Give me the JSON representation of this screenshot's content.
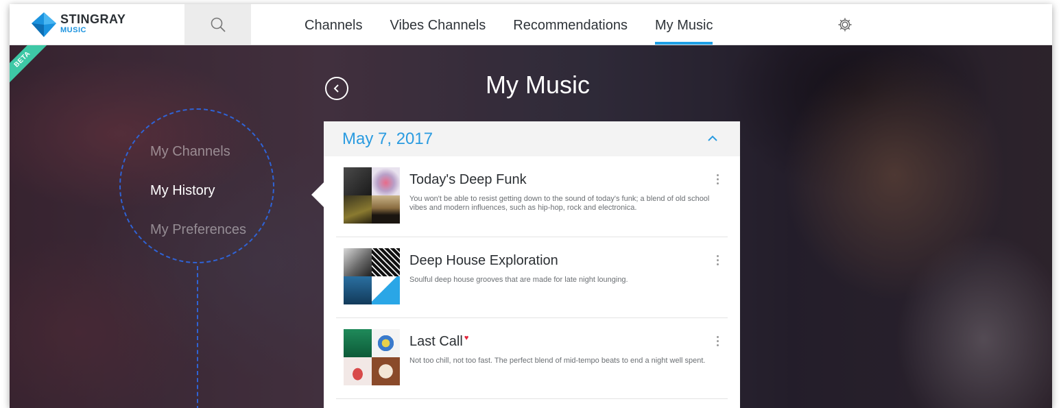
{
  "brand": {
    "name": "STINGRAY",
    "sub": "MUSIC",
    "colors": {
      "accent": "#1ea0e6",
      "dark": "#2b3035",
      "beta": "#3ec8a6",
      "menu_line": "#2f63d6"
    }
  },
  "nav": {
    "search_icon": "search-icon",
    "items": [
      {
        "label": "Channels"
      },
      {
        "label": "Vibes Channels"
      },
      {
        "label": "Recommendations"
      },
      {
        "label": "My Music",
        "active": true
      }
    ],
    "settings_icon": "gear-icon"
  },
  "badge": "BETA",
  "sidebar": {
    "items": [
      {
        "label": "My Channels"
      },
      {
        "label": "My History",
        "active": true
      },
      {
        "label": "My Preferences"
      }
    ]
  },
  "main": {
    "title": "My Music",
    "back_icon": "chevron-left-icon",
    "section": {
      "date": "May 7, 2017",
      "collapse_icon": "chevron-up-icon",
      "channels": [
        {
          "title": "Today's Deep Funk",
          "favorite": false,
          "description": "You won't be able to resist getting down to the sound of today's funk; a blend of old school vibes and modern influences, such as hip-hop, rock and electronica.",
          "menu_icon": "more-vertical-icon"
        },
        {
          "title": "Deep House Exploration",
          "favorite": false,
          "description": "Soulful deep house grooves that are made for late night lounging.",
          "menu_icon": "more-vertical-icon"
        },
        {
          "title": "Last Call",
          "favorite": true,
          "favorite_mark": "♥",
          "description": "Not too chill, not too fast. The perfect blend of mid-tempo beats to end a night well spent.",
          "menu_icon": "more-vertical-icon"
        }
      ]
    }
  }
}
